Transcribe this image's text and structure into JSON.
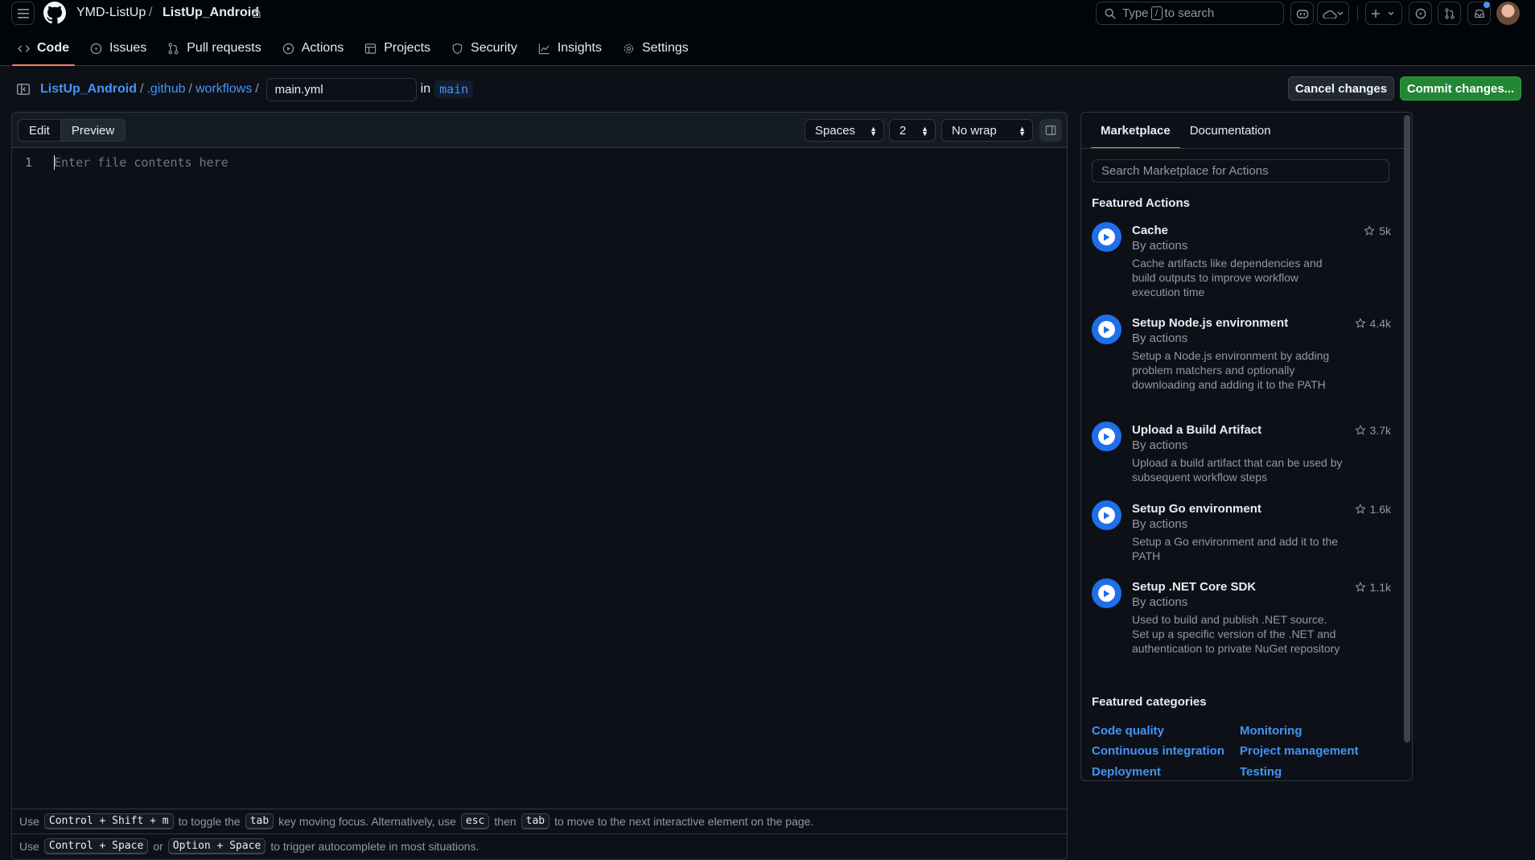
{
  "header": {
    "org": "YMD-ListUp",
    "separator": "/",
    "repo": "ListUp_Android",
    "search_prefix": "Type",
    "search_key": "/",
    "search_suffix": "to search"
  },
  "nav_tabs": [
    {
      "label": "Code",
      "icon": "code-icon",
      "active": true
    },
    {
      "label": "Issues",
      "icon": "issue-opened-icon"
    },
    {
      "label": "Pull requests",
      "icon": "git-pull-request-icon"
    },
    {
      "label": "Actions",
      "icon": "play-icon"
    },
    {
      "label": "Projects",
      "icon": "table-icon"
    },
    {
      "label": "Security",
      "icon": "shield-icon"
    },
    {
      "label": "Insights",
      "icon": "graph-icon"
    },
    {
      "label": "Settings",
      "icon": "gear-icon"
    }
  ],
  "path": {
    "repo": "ListUp_Android",
    "sep": "/",
    "dir1": ".github",
    "dir2": "workflows",
    "filename": "main.yml",
    "in_label": "in",
    "branch": "main"
  },
  "buttons": {
    "cancel": "Cancel changes",
    "commit": "Commit changes..."
  },
  "editor": {
    "tab_edit": "Edit",
    "tab_preview": "Preview",
    "indent_mode": "Spaces",
    "indent_size": "2",
    "wrap_mode": "No wrap",
    "line_number": "1",
    "placeholder": "Enter file contents here"
  },
  "hints": {
    "line1": {
      "use": "Use",
      "k1": "Control + Shift + m",
      "t1": "to toggle the",
      "k2": "tab",
      "t2": "key moving focus. Alternatively, use",
      "k3": "esc",
      "t3": "then",
      "k4": "tab",
      "t4": "to move to the next interactive element on the page."
    },
    "line2": {
      "use": "Use",
      "k1": "Control + Space",
      "t1": "or",
      "k2": "Option + Space",
      "t2": "to trigger autocomplete in most situations."
    }
  },
  "panel": {
    "tab_marketplace": "Marketplace",
    "tab_documentation": "Documentation",
    "search_placeholder": "Search Marketplace for Actions",
    "featured_actions_title": "Featured Actions",
    "actions": [
      {
        "name": "Cache",
        "by": "By actions",
        "stars": "5k",
        "description": "Cache artifacts like dependencies and build outputs to improve workflow execution time"
      },
      {
        "name": "Setup Node.js environment",
        "by": "By actions",
        "stars": "4.4k",
        "description": "Setup a Node.js environment by adding problem matchers and optionally downloading and adding it to the PATH"
      },
      {
        "name": "Upload a Build Artifact",
        "by": "By actions",
        "stars": "3.7k",
        "description": "Upload a build artifact that can be used by subsequent workflow steps"
      },
      {
        "name": "Setup Go environment",
        "by": "By actions",
        "stars": "1.6k",
        "description": "Setup a Go environment and add it to the PATH"
      },
      {
        "name": "Setup .NET Core SDK",
        "by": "By actions",
        "stars": "1.1k",
        "description": "Used to build and publish .NET source. Set up a specific version of the .NET and authentication to private NuGet repository"
      }
    ],
    "featured_categories_title": "Featured categories",
    "categories": [
      "Code quality",
      "Monitoring",
      "Continuous integration",
      "Project management",
      "Deployment",
      "Testing"
    ]
  },
  "colors": {
    "accent_link": "#4493f8",
    "commit_green": "#238636",
    "tab_underline": "#f78166",
    "background": "#0d1117"
  }
}
